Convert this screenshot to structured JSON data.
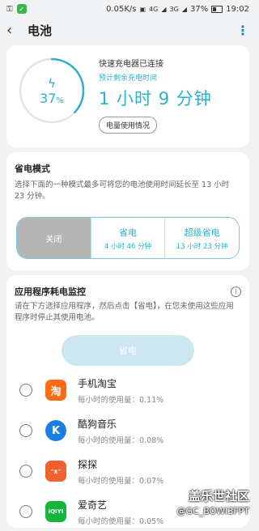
{
  "status_bar": {
    "speed": "0.05K/s",
    "net": "4G",
    "net2": "3G",
    "battery": "37%",
    "time": "19:02"
  },
  "header": {
    "title": "电池",
    "back_icon": "arrow-back-icon",
    "more_icon": "more-vert-icon"
  },
  "battery_card": {
    "percent": "37",
    "percent_unit": "%",
    "level_fraction": 0.37,
    "charger_status": "快速充电器已连接",
    "remaining_label": "预计剩余充电时间",
    "remaining_time": "1 小时 9 分钟",
    "usage_button": "电量使用情况"
  },
  "power_mode": {
    "title": "省电模式",
    "description": "选择下面的一种模式最多可将您的电池使用时间延长至 13 小时 23 分钟。",
    "options": [
      {
        "name": "关闭",
        "sub": ""
      },
      {
        "name": "省电",
        "sub": "4 小时 46 分钟"
      },
      {
        "name": "超级省电",
        "sub": "13 小时 23 分钟"
      }
    ]
  },
  "app_monitor": {
    "title": "应用程序耗电监控",
    "description": "请在下方选择应用程序，然后点击【省电】，在您未使用这些应用程序时停止其使用电池。",
    "save_button": "省电",
    "apps": [
      {
        "name": "手机淘宝",
        "usage": "每小时的使用量：0.11%",
        "icon_text": "淘",
        "color": "#ff6a13"
      },
      {
        "name": "酷狗音乐",
        "usage": "每小时的使用量：0.08%",
        "icon_text": "K",
        "color": "#1a7fe0"
      },
      {
        "name": "探探",
        "usage": "每小时的使用量：0.07%",
        "icon_text": "ᵔᴥᵔ",
        "color": "#f0612d"
      },
      {
        "name": "爱奇艺",
        "usage": "每小时的使用量：0.05%",
        "icon_text": "iQIYI",
        "color": "#16b63e"
      }
    ]
  },
  "watermark": {
    "line1": "盖乐世社区",
    "line2": "@GC_BOWI3FPT"
  },
  "colors": {
    "accent": "#2ab2cc",
    "ring_track": "#dfe3e6"
  }
}
